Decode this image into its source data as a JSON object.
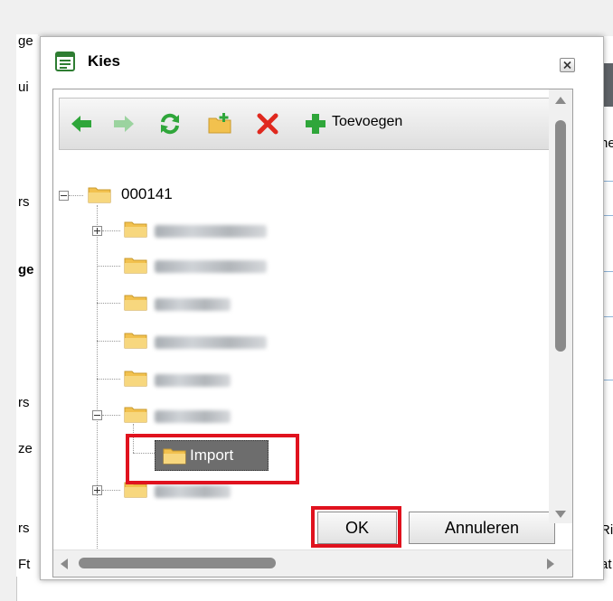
{
  "background": {
    "left_fragments": [
      "ge",
      "ui",
      "rs",
      "ge",
      "rs",
      "ze",
      "rs",
      "Ft"
    ],
    "right_fragments": [
      "he",
      "Ri",
      "at"
    ]
  },
  "dialog": {
    "title": "Kies",
    "toolbar": {
      "add_label": "Toevoegen",
      "icons": [
        "arrow-left-icon",
        "arrow-right-icon",
        "refresh-icon",
        "new-folder-icon",
        "delete-icon",
        "add-icon"
      ]
    },
    "tree": {
      "root_label": "000141",
      "selected_label": "Import"
    },
    "buttons": {
      "ok": "OK",
      "cancel": "Annuleren"
    },
    "colors": {
      "highlight": "#e0121e",
      "selection": "#6d6d6d",
      "folder": "#f2c14e",
      "arrow_green": "#2fa63a"
    }
  }
}
